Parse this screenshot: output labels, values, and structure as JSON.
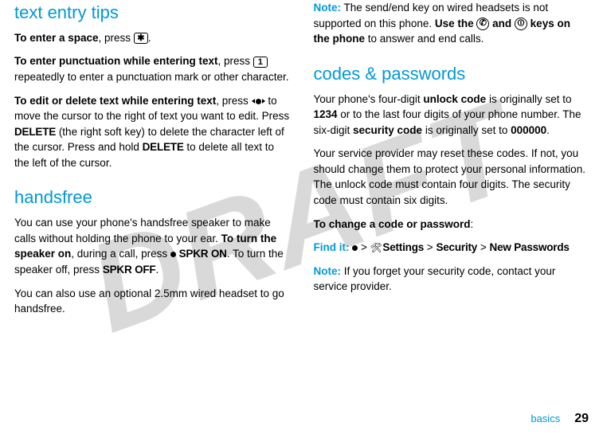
{
  "watermark": "DRAFT",
  "left": {
    "h_tips": "text entry tips",
    "p1_a": "To enter a space",
    "p1_b": ", press ",
    "p1_key": "✱",
    "p1_c": ".",
    "p2_a": "To enter punctuation while entering text",
    "p2_b": ", press ",
    "p2_key": "1",
    "p2_c": " repeatedly to enter a punctuation mark or other character.",
    "p3_a": "To edit or delete text while entering text",
    "p3_b": ", press ",
    "p3_c": " to move the cursor to the right of text you want to edit. Press ",
    "p3_del1": "DELETE",
    "p3_d": " (the right soft key) to delete the character left of the cursor. Press and hold ",
    "p3_del2": "DELETE",
    "p3_e": " to delete all text to the left of the cursor.",
    "h_hands": "handsfree",
    "p4_a": "You can use your phone's handsfree speaker to make calls without holding the phone to your ear. ",
    "p4_b": "To turn the speaker on",
    "p4_c": ", during a call, press ",
    "p4_spkr": "SPKR ON",
    "p4_d": ". To turn the speaker off, press ",
    "p4_spkroff": "SPKR OFF",
    "p4_e": ".",
    "p5": "You can also use an optional 2.5mm wired headset to go handsfree."
  },
  "right": {
    "p1_a": "Note:",
    "p1_b": " The send/end key on wired headsets is not supported on this phone. ",
    "p1_c": "Use the ",
    "p1_key1": "✆",
    "p1_d": " and ",
    "p1_key2": "⏼",
    "p1_e": " keys on the phone",
    "p1_f": " to answer and end calls.",
    "h_codes": "codes & passwords",
    "p2_a": "Your phone's four-digit ",
    "p2_b": "unlock code",
    "p2_c": " is originally set to ",
    "p2_d": "1234",
    "p2_e": " or to the last four digits of your phone number. The six-digit ",
    "p2_f": "security code",
    "p2_g": " is originally set to ",
    "p2_h": "000000",
    "p2_i": ".",
    "p3": "Your service provider may reset these codes. If not, you should change them to protect your personal information. The unlock code must contain four digits. The security code must contain six digits.",
    "p4_a": "To change a code or password",
    "p4_b": ":",
    "find_a": "Find it: ",
    "find_b": " > ",
    "find_settings": "Settings",
    "find_c": " > ",
    "find_sec": "Security",
    "find_d": " > ",
    "find_newpw": "New Passwords",
    "p5_a": "Note:",
    "p5_b": " If you forget your security code, contact your service provider."
  },
  "footer": {
    "label": "basics",
    "page": "29"
  }
}
